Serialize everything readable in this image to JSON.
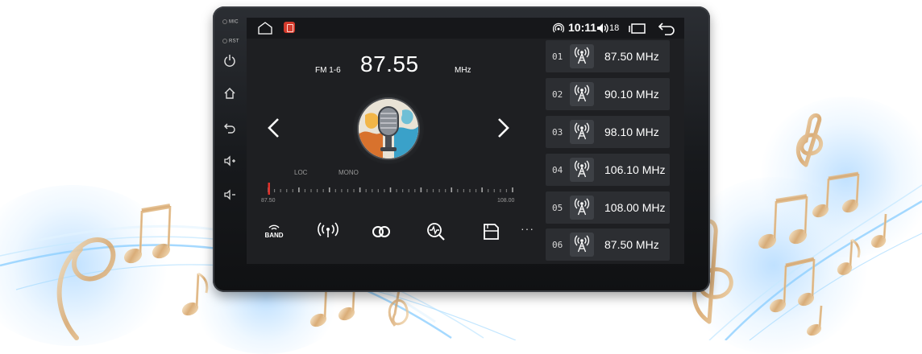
{
  "bezel": {
    "mic_label": "MIC",
    "rst_label": "RST"
  },
  "status_bar": {
    "time": "10:11",
    "volume": "18"
  },
  "radio": {
    "band": "FM 1-6",
    "frequency": "87.55",
    "unit": "MHz",
    "tags": [
      "LOC",
      "MONO"
    ],
    "scale_min": "87.50",
    "scale_max": "108.00"
  },
  "controls": [
    {
      "icon": "band-icon",
      "label": "BAND"
    },
    {
      "icon": "antenna-icon",
      "label": ""
    },
    {
      "icon": "stereo-icon",
      "label": ""
    },
    {
      "icon": "scan-search-icon",
      "label": ""
    },
    {
      "icon": "save-icon",
      "label": ""
    }
  ],
  "more_label": "···",
  "presets": [
    {
      "num": "01",
      "freq": "87.50 MHz"
    },
    {
      "num": "02",
      "freq": "90.10 MHz"
    },
    {
      "num": "03",
      "freq": "98.10 MHz"
    },
    {
      "num": "04",
      "freq": "106.10 MHz"
    },
    {
      "num": "05",
      "freq": "108.00 MHz"
    },
    {
      "num": "06",
      "freq": "87.50 MHz"
    }
  ],
  "colors": {
    "accent": "#e0312b",
    "screen_bg": "#1e1f22",
    "preset_bg": "#2c2e32"
  }
}
